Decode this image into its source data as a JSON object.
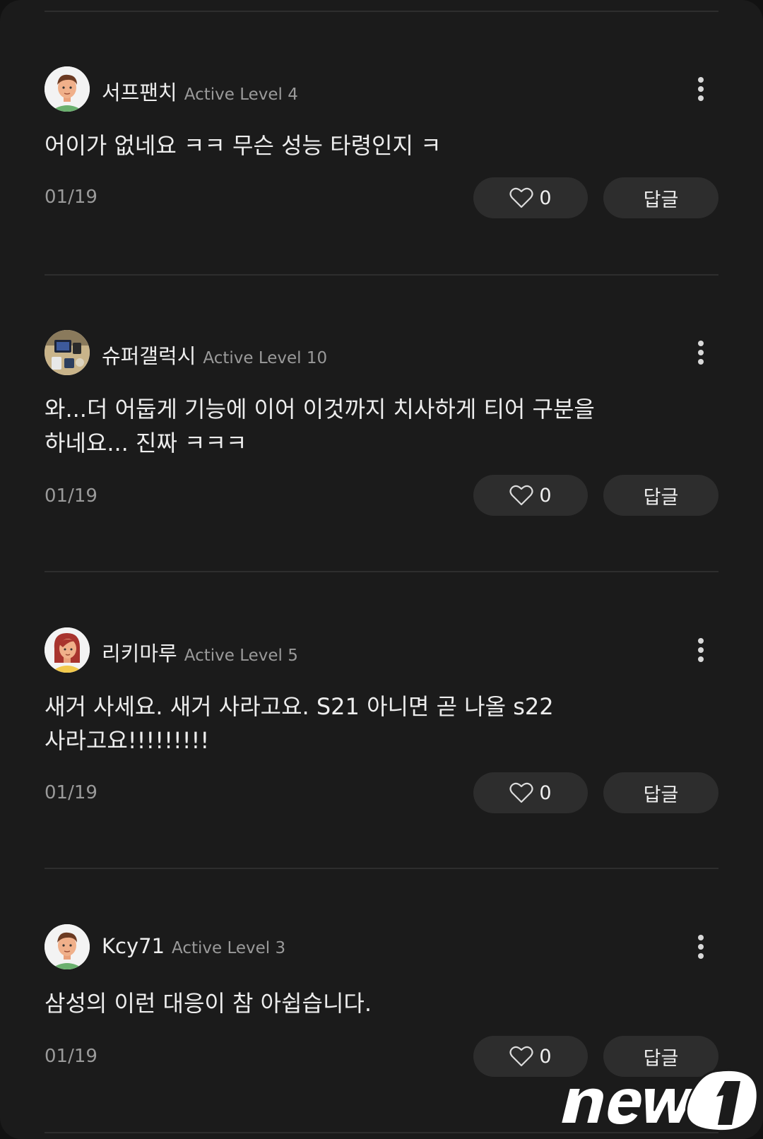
{
  "comments": [
    {
      "username": "서프팬치",
      "level": "Active Level 4",
      "text": "어이가 없네요 ㅋㅋ 무슨 성능 타령인지 ㅋ",
      "date": "01/19",
      "likes": "0",
      "reply_label": "답글"
    },
    {
      "username": "슈퍼갤럭시",
      "level": "Active Level 10",
      "text": "와...더 어둡게 기능에 이어 이것까지 치사하게 티어 구분을\n하네요... 진짜 ㅋㅋㅋ",
      "date": "01/19",
      "likes": "0",
      "reply_label": "답글"
    },
    {
      "username": "리키마루",
      "level": "Active Level 5",
      "text": "새거 사세요. 새거 사라고요. S21 아니면 곧 나올 s22\n사라고요!!!!!!!!!",
      "date": "01/19",
      "likes": "0",
      "reply_label": "답글"
    },
    {
      "username": "Kcy71",
      "level": "Active Level 3",
      "text": "삼성의 이런 대응이 참 아쉽습니다.",
      "date": "01/19",
      "likes": "0",
      "reply_label": "답글"
    }
  ],
  "icons": {
    "more": "more-vertical-icon",
    "like": "heart-outline-icon"
  },
  "colors": {
    "background": "#1b1b1b",
    "button": "#2d2d2d",
    "muted_text": "#9a9a9a",
    "text": "#eeeeee"
  }
}
